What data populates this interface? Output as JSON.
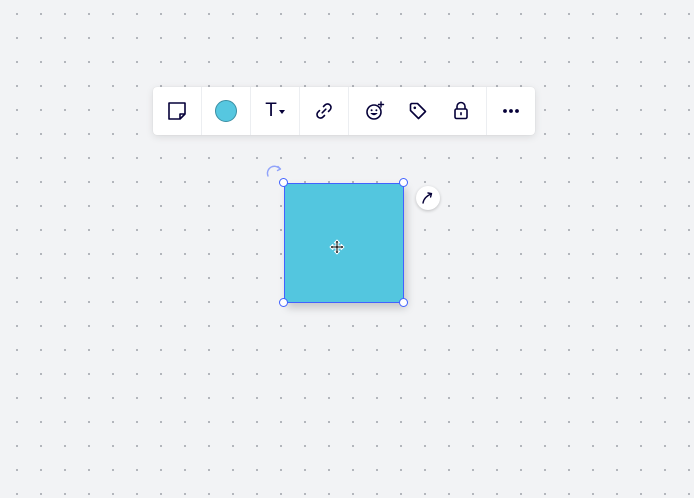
{
  "canvas": {
    "background_color": "#f2f3f5",
    "dot_color": "#a9acb3"
  },
  "toolbar": {
    "items": [
      {
        "name": "shape-type",
        "icon": "sticky-note-shape-icon"
      },
      {
        "name": "fill-color",
        "icon": "color-swatch",
        "color": "#56c7e0"
      },
      {
        "name": "text-format",
        "label": "T",
        "icon": "caret-down-icon"
      },
      {
        "name": "link",
        "icon": "link-icon"
      },
      {
        "name": "reaction",
        "icon": "add-emoji-icon"
      },
      {
        "name": "tag",
        "icon": "tag-icon"
      },
      {
        "name": "lock",
        "icon": "lock-icon"
      },
      {
        "name": "more",
        "icon": "more-horizontal-icon"
      }
    ]
  },
  "shape": {
    "type": "square",
    "fill_color": "#53c6df",
    "border_color": "#3b8fb5",
    "selected": true
  },
  "selection": {
    "handle_color": "#4262ff",
    "handles": [
      "top-left",
      "top-right",
      "bottom-left",
      "bottom-right"
    ]
  },
  "connector": {
    "icon": "curved-arrow-icon"
  },
  "cursor": {
    "icon": "move-cursor-icon"
  },
  "accent_color": "#4262ff"
}
